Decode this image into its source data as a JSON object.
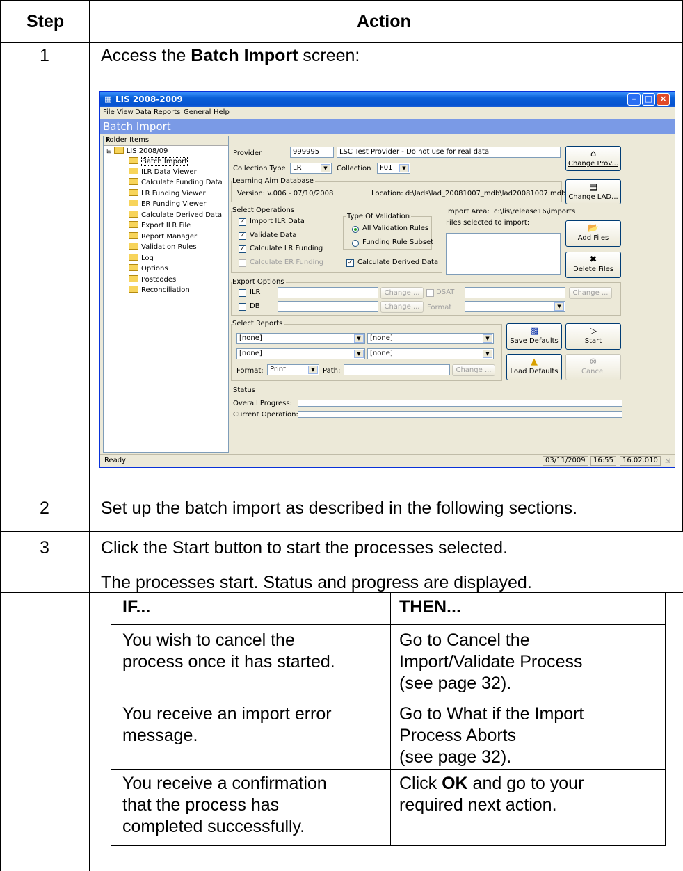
{
  "headers": {
    "step": "Step",
    "action": "Action"
  },
  "steps": [
    {
      "num": "1",
      "pre": "Access the ",
      "bold": "Batch Import",
      "post": " screen:"
    },
    {
      "num": "2",
      "text": "Set up the batch import as described in the following sections."
    },
    {
      "num": "3",
      "line1": "Click the Start button to start the processes selected.",
      "line2": "The processes start. Status and progress are displayed."
    }
  ],
  "if_table": {
    "headers": {
      "if": "IF...",
      "then": "THEN..."
    },
    "rows": [
      {
        "if": [
          "You wish to cancel the",
          "process once it has started."
        ],
        "then": [
          "Go to Cancel the",
          "Import/Validate Process",
          "(see page 32)."
        ]
      },
      {
        "if": [
          "You receive an import error",
          "message."
        ],
        "then": [
          "Go to What if the Import",
          "Process Aborts",
          "(see page 32)."
        ]
      },
      {
        "if": [
          "You receive a confirmation",
          "that the process has",
          "completed successfully."
        ],
        "then_pre": "Click ",
        "then_bold": "OK",
        "then_post": " and go to your",
        "then_line2": "required next action."
      }
    ]
  },
  "window": {
    "title": "LIS 2008-2009",
    "menu": [
      "File",
      "View",
      "Data",
      "Reports",
      "General",
      "Help"
    ],
    "banner": "Batch Import",
    "tree": {
      "header": "Folder Items",
      "root": "LIS 2008/09",
      "items": [
        "Batch Import",
        "ILR Data Viewer",
        "Calculate Funding Data",
        "LR Funding Viewer",
        "ER Funding Viewer",
        "Calculate Derived Data",
        "Export ILR File",
        "Report Manager",
        "Validation Rules",
        "Log",
        "Options",
        "Postcodes",
        "Reconciliation"
      ]
    },
    "provider_label": "Provider",
    "provider_code": "999995",
    "provider_name": "LSC Test Provider - Do not use for real data",
    "change_prov": "Change Prov...",
    "collection_type_label": "Collection Type",
    "collection_type": "LR",
    "collection_label": "Collection",
    "collection": "F01",
    "lad_group": "Learning Aim Database",
    "lad_version": "Version:  v.006 - 07/10/2008",
    "lad_location": "Location:  d:\\lads\\lad_20081007_mdb\\lad20081007.mdb",
    "change_lad": "Change LAD...",
    "ops_group": "Select Operations",
    "ops": [
      "Import ILR Data",
      "Validate Data",
      "Calculate LR Funding",
      "Calculate ER Funding"
    ],
    "validation_group": "Type Of Validation",
    "validation": [
      "All Validation Rules",
      "Funding Rule Subset"
    ],
    "calc_derived": "Calculate Derived Data",
    "import_area_label": "Import Area:",
    "import_area": "c:\\lis\\release16\\imports",
    "files_label": "Files selected to import:",
    "add_files": "Add Files",
    "delete_files": "Delete Files",
    "export_group": "Export Options",
    "export_ilr": "ILR",
    "export_db": "DB",
    "export_dsat": "DSAT",
    "change": "Change ...",
    "format_label": "Format",
    "reports_group": "Select Reports",
    "report_values": [
      "[none]",
      "[none]",
      "[none]",
      "[none]"
    ],
    "format2_label": "Format:",
    "format2": "Print",
    "path_label": "Path:",
    "save_defaults": "Save Defaults",
    "load_defaults": "Load Defaults",
    "start": "Start",
    "cancel": "Cancel",
    "status_label": "Status",
    "overall_progress": "Overall Progress:",
    "current_operation": "Current Operation:",
    "statusbar": {
      "ready": "Ready",
      "date": "03/11/2009",
      "time": "16:55",
      "version": "16.02.010"
    }
  }
}
